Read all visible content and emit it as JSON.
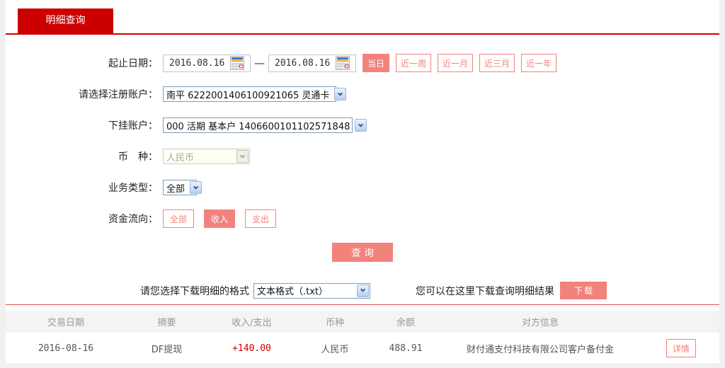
{
  "tab": {
    "label": "明细查询"
  },
  "form": {
    "date_row": {
      "label": "起止日期：",
      "start_date": "2016.08.16",
      "end_date": "2016.08.16",
      "separator": "—",
      "quick_buttons": [
        {
          "label": "当日",
          "active": true
        },
        {
          "label": "近一周",
          "active": false
        },
        {
          "label": "近一月",
          "active": false
        },
        {
          "label": "近三月",
          "active": false
        },
        {
          "label": "近一年",
          "active": false
        }
      ]
    },
    "register_account": {
      "label": "请选择注册账户：",
      "value": "南平 6222001406100921065 灵通卡"
    },
    "sub_account": {
      "label": "下挂账户：",
      "value": "000 活期 基本户 1406600101102571848"
    },
    "currency": {
      "label": "币　种：",
      "value": "人民币",
      "disabled": true
    },
    "business_type": {
      "label": "业务类型：",
      "value": "全部"
    },
    "fund_flow": {
      "label": "资金流向：",
      "options": [
        {
          "label": "全部",
          "active": false
        },
        {
          "label": "收入",
          "active": true
        },
        {
          "label": "支出",
          "active": false
        }
      ]
    },
    "query_button": "查询",
    "download": {
      "format_label": "请您选择下载明细的格式",
      "format_value": "文本格式（.txt）",
      "hint": "您可以在这里下载查询明细结果",
      "button": "下载"
    }
  },
  "table": {
    "headers": [
      "交易日期",
      "摘要",
      "收入/支出",
      "币种",
      "余额",
      "对方信息"
    ],
    "rows": [
      {
        "date": "2016-08-16",
        "summary": "DF提现",
        "amount": "+140.00",
        "currency": "人民币",
        "balance": "488.91",
        "counterparty": "财付通支付科技有限公司客户备付金",
        "detail_button": "详情"
      }
    ]
  },
  "colors": {
    "tab_red": "#cc0000",
    "accent_salmon": "#f2827c",
    "table_top_line": "#e4554a",
    "amount_red": "#cc0000",
    "header_bg": "#f4f4f4"
  }
}
